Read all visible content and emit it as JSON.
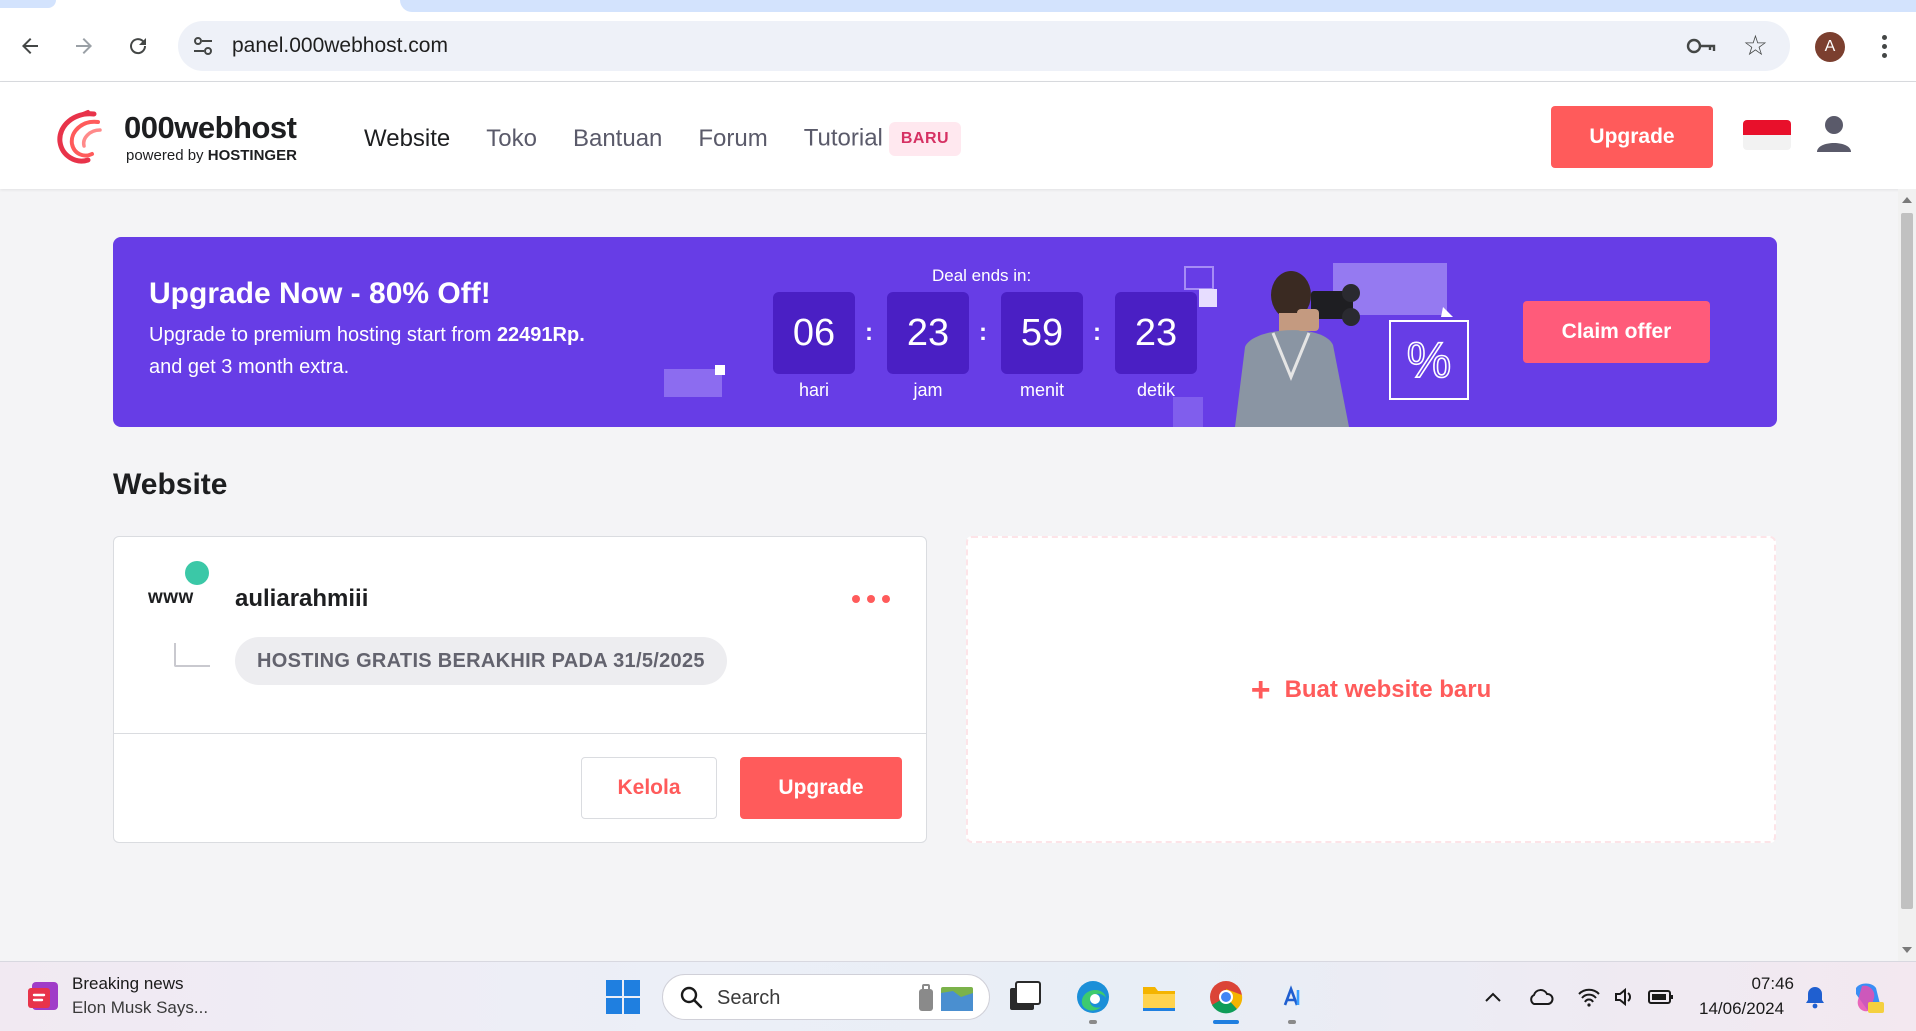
{
  "browser": {
    "url": "panel.000webhost.com",
    "profile_initial": "A",
    "icons": [
      "back-icon",
      "forward-icon",
      "reload-icon",
      "site-info-icon",
      "password-key-icon",
      "bookmark-star-icon",
      "more-menu-icon"
    ]
  },
  "header": {
    "logo_name": "000webhost",
    "logo_sub_prefix": "powered by",
    "logo_sub_brand": "HOSTINGER",
    "nav": [
      {
        "label": "Website",
        "active": true
      },
      {
        "label": "Toko",
        "active": false
      },
      {
        "label": "Bantuan",
        "active": false
      },
      {
        "label": "Forum",
        "active": false
      },
      {
        "label": "Tutorial",
        "active": false
      }
    ],
    "badge": "BARU",
    "upgrade_label": "Upgrade"
  },
  "banner": {
    "title": "Upgrade Now - 80% Off!",
    "text_prefix": "Upgrade to premium hosting start from",
    "price": "22491Rp.",
    "text_suffix": "and get 3 month extra.",
    "deal_label": "Deal ends in:",
    "countdown": [
      {
        "value": "06",
        "label": "hari"
      },
      {
        "value": "23",
        "label": "jam"
      },
      {
        "value": "59",
        "label": "menit"
      },
      {
        "value": "23",
        "label": "detik"
      }
    ],
    "separator": ":",
    "cta_label": "Claim offer",
    "percent_symbol": "%"
  },
  "websites": {
    "section_title": "Website",
    "items": [
      {
        "icon_text": "www",
        "name": "auliarahmiii",
        "status_pill": "HOSTING GRATIS BERAKHIR PADA 31/5/2025",
        "manage_label": "Kelola",
        "upgrade_label": "Upgrade"
      }
    ],
    "new_site_label": "Buat website baru"
  },
  "taskbar": {
    "news_title": "Breaking news",
    "news_sub": "Elon Musk Says...",
    "search_placeholder": "Search",
    "time": "07:46",
    "date": "14/06/2024"
  },
  "colors": {
    "accent": "#ff5b5b",
    "banner": "#673de6",
    "countdown_box": "#4a1fc4",
    "status_dot": "#3bc8a7"
  }
}
